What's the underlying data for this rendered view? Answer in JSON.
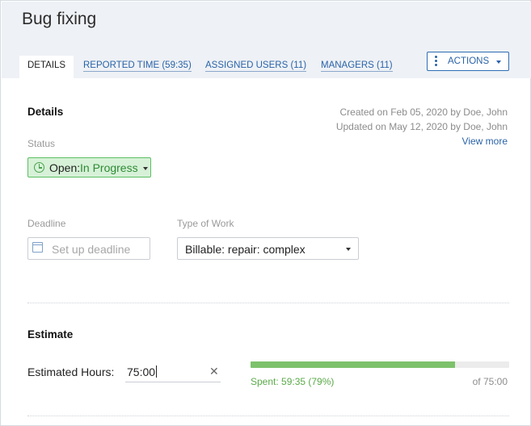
{
  "page": {
    "title": "Bug fixing"
  },
  "tabs": [
    {
      "label": "DETAILS"
    },
    {
      "label": "REPORTED TIME (59:35)"
    },
    {
      "label": "ASSIGNED USERS (11)"
    },
    {
      "label": "MANAGERS (11)"
    }
  ],
  "actions": {
    "label": "ACTIONS"
  },
  "details": {
    "title": "Details",
    "created": "Created on Feb 05, 2020 by Doe, John",
    "updated": "Updated on May 12, 2020 by Doe, John",
    "view_more": "View more",
    "status_label": "Status",
    "status_prefix": "Open:",
    "status_value": "In Progress",
    "deadline_label": "Deadline",
    "deadline_placeholder": "Set up deadline",
    "type_of_work_label": "Type of Work",
    "type_of_work_value": "Billable: repair: complex"
  },
  "estimate": {
    "title": "Estimate",
    "hours_label": "Estimated Hours:",
    "hours_value": "75:00",
    "spent_text": "Spent: 59:35 (79%)",
    "total_text": "of 75:00",
    "progress_percent": 79
  },
  "colors": {
    "accent": "#2a63a8",
    "status_bg": "#d6f1d7",
    "status_border": "#5cbf63",
    "progress": "#7dc26b"
  }
}
